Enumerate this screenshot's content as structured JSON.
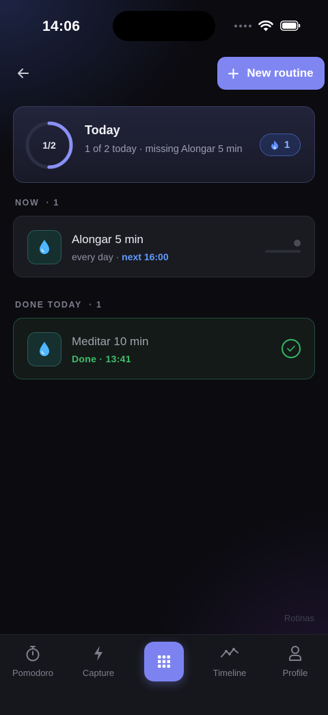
{
  "status_bar": {
    "time": "14:06"
  },
  "header": {
    "new_routine_label": "New routine"
  },
  "today_card": {
    "progress_label": "1/2",
    "progress_fraction": 0.5,
    "title": "Today",
    "subtitle": "1 of 2 today · missing Alongar 5 min",
    "streak_count": "1"
  },
  "sections": {
    "now": {
      "label": "NOW",
      "count": "· 1"
    },
    "done_today": {
      "label": "DONE TODAY",
      "count": "· 1"
    }
  },
  "routines_now": [
    {
      "title": "Alongar 5 min",
      "schedule": "every day · ",
      "next": "next 16:00",
      "icon": "water-drop-icon"
    }
  ],
  "routines_done": [
    {
      "title": "Meditar 10 min",
      "status": "Done · 13:41",
      "icon": "water-drop-icon"
    }
  ],
  "footer_label": "Rotinas",
  "tabs": [
    {
      "label": "Pomodoro",
      "icon": "stopwatch-icon"
    },
    {
      "label": "Capture",
      "icon": "lightning-icon"
    },
    {
      "label": "",
      "icon": "grid-icon"
    },
    {
      "label": "Timeline",
      "icon": "line-chart-icon"
    },
    {
      "label": "Profile",
      "icon": "person-icon"
    }
  ],
  "colors": {
    "accent": "#7f86f2",
    "done_green": "#3fbf6a",
    "next_blue": "#5f9bff",
    "drop_blue": "#4fb6ff"
  }
}
